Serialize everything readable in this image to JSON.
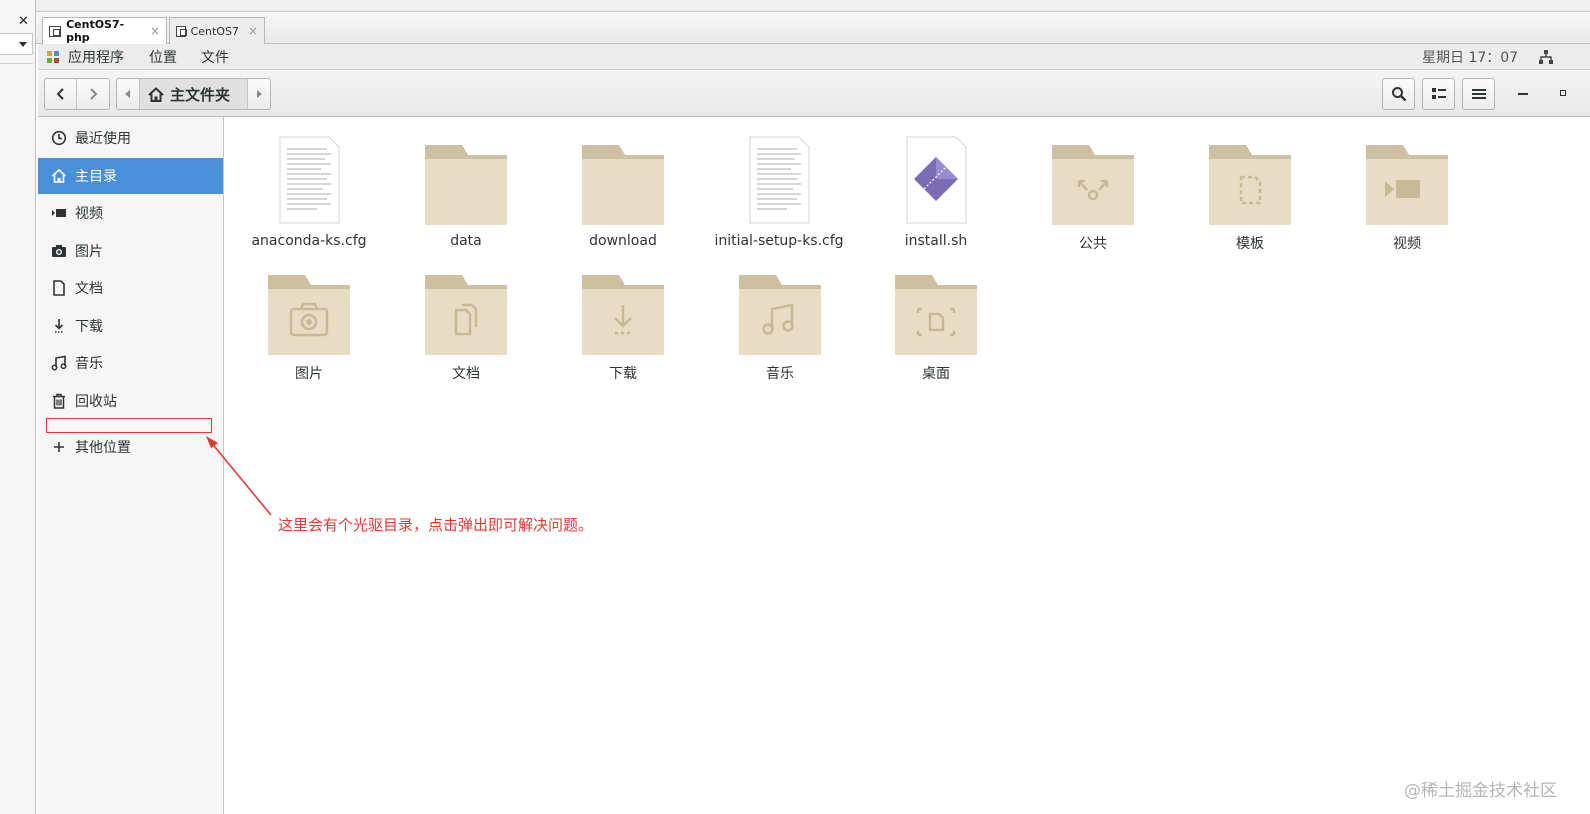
{
  "vm_tabs": [
    {
      "label": "CentOS7-php",
      "active": true
    },
    {
      "label": "CentOS7",
      "active": false
    }
  ],
  "gnome_bar": {
    "apps_menu": "应用程序",
    "places_menu": "位置",
    "files_menu": "文件",
    "clock": "星期日 17：07"
  },
  "header": {
    "breadcrumb": "主文件夹"
  },
  "sidebar": {
    "items": [
      {
        "label": "最近使用",
        "icon": "clock-icon"
      },
      {
        "label": "主目录",
        "icon": "home-icon",
        "selected": true
      },
      {
        "label": "视频",
        "icon": "video-icon"
      },
      {
        "label": "图片",
        "icon": "camera-icon"
      },
      {
        "label": "文档",
        "icon": "document-icon"
      },
      {
        "label": "下载",
        "icon": "download-icon"
      },
      {
        "label": "音乐",
        "icon": "music-icon"
      },
      {
        "label": "回收站",
        "icon": "trash-icon"
      }
    ],
    "other_locations": "其他位置"
  },
  "files": [
    {
      "name": "anaconda-ks.cfg",
      "type": "text"
    },
    {
      "name": "data",
      "type": "folder"
    },
    {
      "name": "download",
      "type": "folder"
    },
    {
      "name": "initial-setup-ks.cfg",
      "type": "text"
    },
    {
      "name": "install.sh",
      "type": "script"
    },
    {
      "name": "公共",
      "type": "folder-share"
    },
    {
      "name": "模板",
      "type": "folder-template"
    },
    {
      "name": "视频",
      "type": "folder-video"
    },
    {
      "name": "图片",
      "type": "folder-pictures"
    },
    {
      "name": "文档",
      "type": "folder-documents"
    },
    {
      "name": "下载",
      "type": "folder-download"
    },
    {
      "name": "音乐",
      "type": "folder-music"
    },
    {
      "name": "桌面",
      "type": "folder-desktop"
    }
  ],
  "annotation": "这里会有个光驱目录，点击弹出即可解决问题。",
  "watermark": "@稀土掘金技术社区",
  "colors": {
    "accent": "#4a90d9",
    "folder": "#e8dcc4",
    "annotation": "#e53935"
  }
}
